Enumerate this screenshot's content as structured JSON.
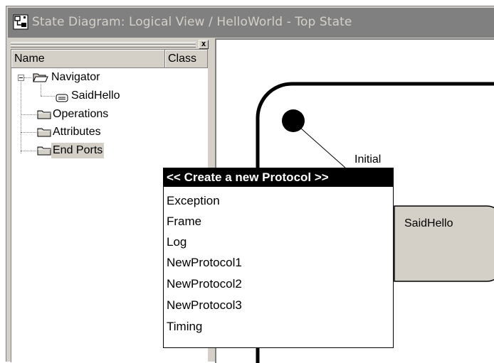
{
  "window": {
    "title": "State Diagram: Logical View / HelloWorld - Top State",
    "icon": "state-diagram-icon"
  },
  "side_panel": {
    "close_label": "x",
    "columns": [
      "Name",
      "Class"
    ],
    "tree": {
      "navigator": "Navigator",
      "said_hello": "SaidHello",
      "operations": "Operations",
      "attributes": "Attributes",
      "end_ports": "End Ports"
    }
  },
  "diagram": {
    "transition_label": "Initial",
    "state_label": "SaidHello"
  },
  "popup": {
    "items": [
      "<< Create a new Protocol >>",
      "Exception",
      "Frame",
      "Log",
      "NewProtocol1",
      "NewProtocol2",
      "NewProtocol3",
      "Timing"
    ]
  },
  "colors": {
    "chrome": "#d4d0c8",
    "titlebar_inactive": "#808080",
    "highlight": "#000000"
  }
}
